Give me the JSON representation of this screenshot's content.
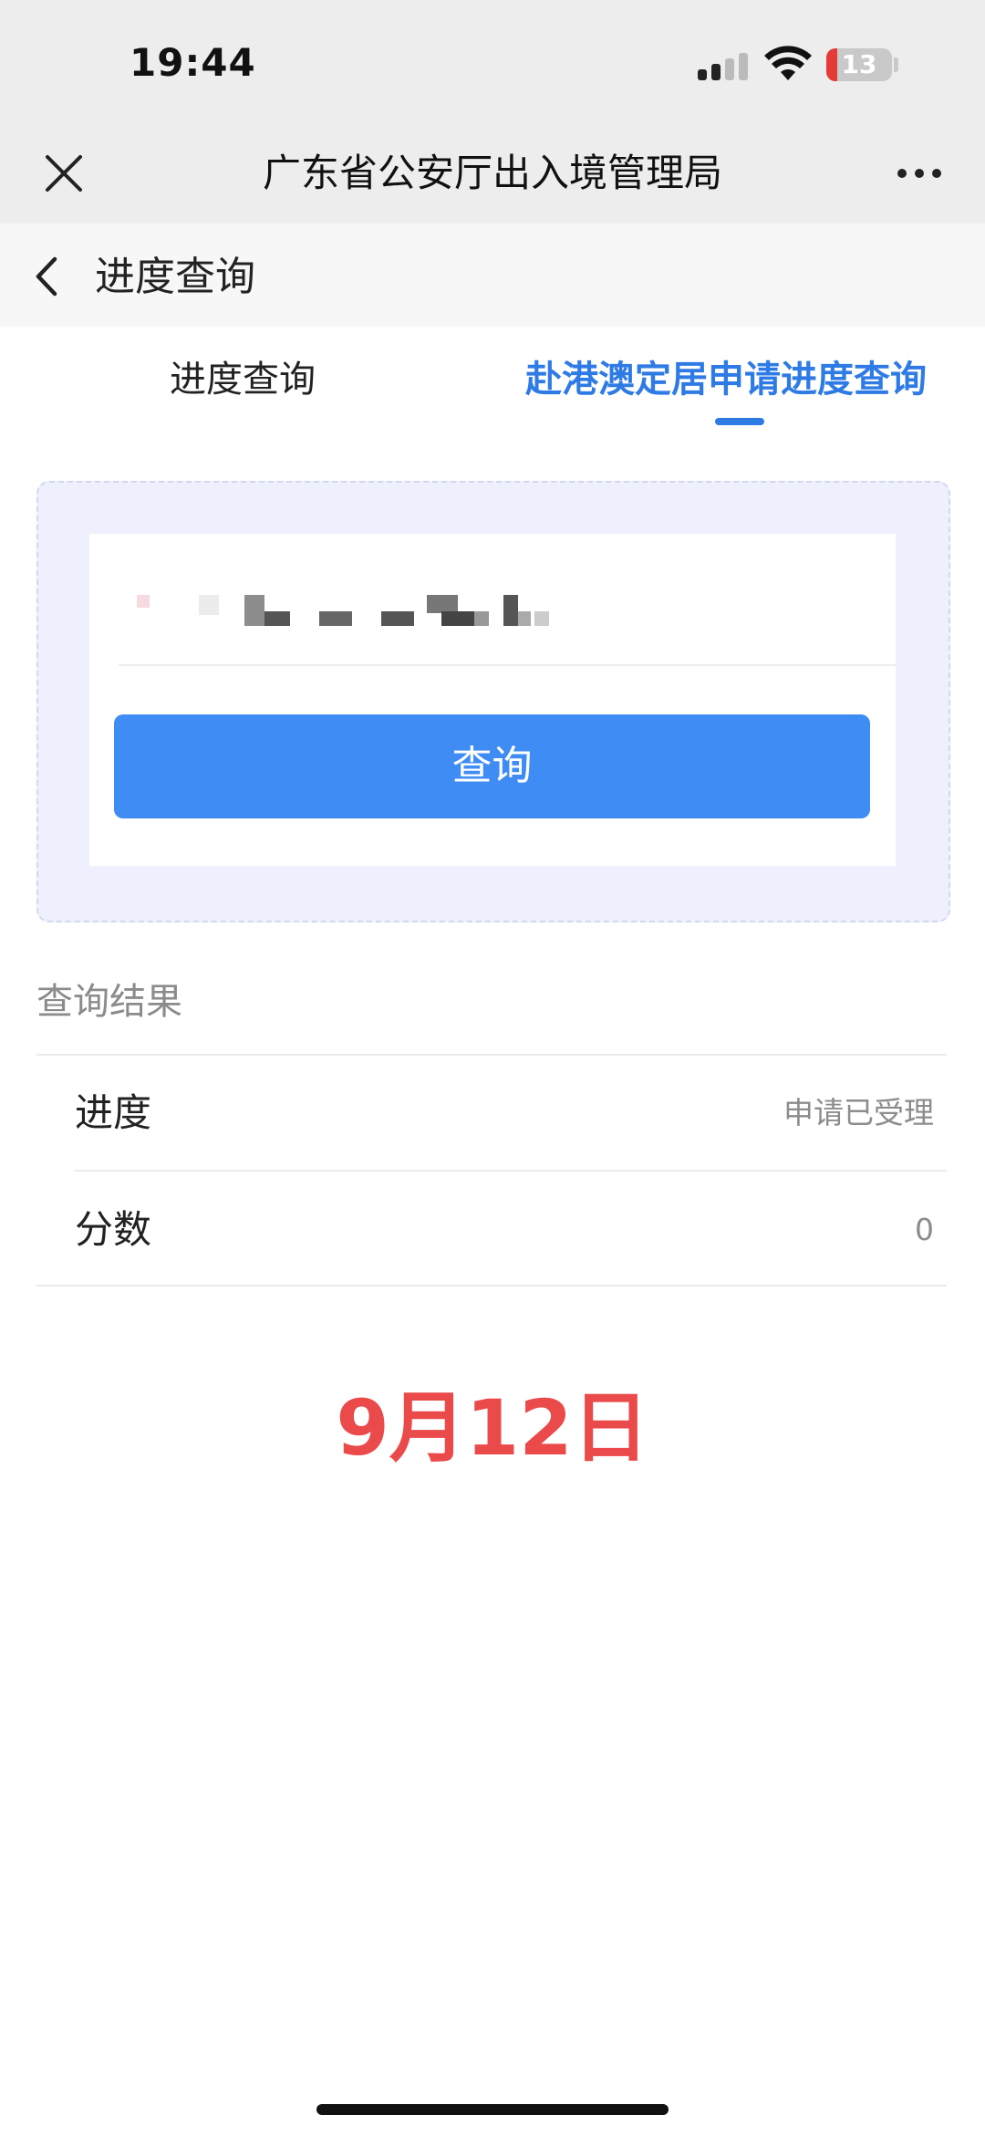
{
  "status_bar": {
    "time": "19:44",
    "battery_level": "13",
    "signal_icon": "signal-bars-icon",
    "wifi_icon": "wifi-icon",
    "battery_color": "#e53a35"
  },
  "nav_header": {
    "title": "广东省公安厅出入境管理局",
    "close_icon": "close-icon",
    "more_icon": "more-icon"
  },
  "sub_header": {
    "title": "进度查询",
    "back_icon": "chevron-left-icon"
  },
  "tabs": [
    {
      "label": "进度查询",
      "active": false
    },
    {
      "label": "赴港澳定居申请进度查询",
      "active": true
    }
  ],
  "query_form": {
    "input_value": "",
    "button_label": "查询"
  },
  "results": {
    "label": "查询结果",
    "rows": [
      {
        "key": "进度",
        "value": "申请已受理"
      },
      {
        "key": "分数",
        "value": "0"
      }
    ]
  },
  "annotation": {
    "date_text": "9月12日",
    "color": "#ea4a49"
  },
  "colors": {
    "accent": "#2f7be6",
    "button": "#3f8cf4",
    "panel_bg": "#eef0fd"
  }
}
